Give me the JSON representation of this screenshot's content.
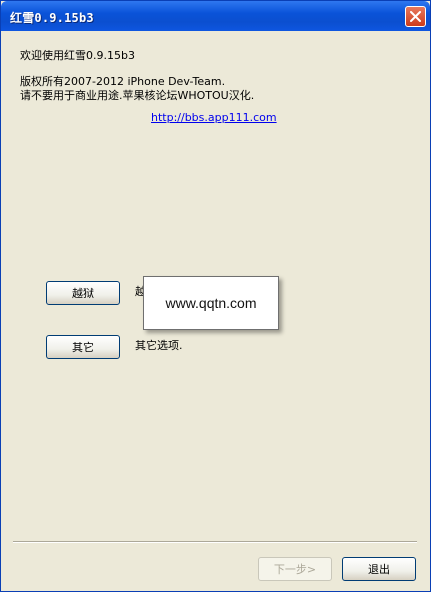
{
  "window": {
    "title": "红雪0.9.15b3"
  },
  "main": {
    "welcome": "欢迎使用红雪0.9.15b3",
    "copyright": "版权所有2007-2012 iPhone Dev-Team.",
    "notice": "请不要用于商业用途.苹果核论坛WHOTOU汉化.",
    "link": "http://bbs.app111.com",
    "options": [
      {
        "button": "越狱",
        "desc": "越"
      },
      {
        "button": "其它",
        "desc": "其它选项."
      }
    ]
  },
  "overlay": {
    "text": "www.qqtn.com"
  },
  "footer": {
    "next_label": "下一步>",
    "exit_label": "退出"
  },
  "colors": {
    "titlebar": "#0a53d9",
    "dialog_bg": "#ece9d8",
    "close_button": "#cc3b1b",
    "link": "#0000ee"
  },
  "icons": {
    "close": "close-icon"
  }
}
